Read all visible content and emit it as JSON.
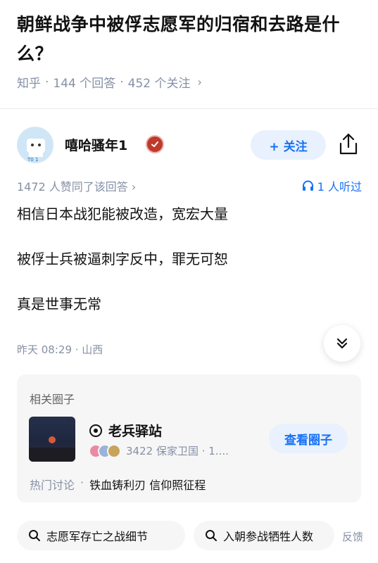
{
  "question": {
    "title": "朝鲜战争中被俘志愿军的归宿和去路是什么？",
    "source": "知乎",
    "answers": "144 个回答",
    "followers": "452 个关注"
  },
  "author": {
    "name": "嘻哈骚年1",
    "follow_label": "+ 关注"
  },
  "stats": {
    "agree": "1472 人赞同了该回答",
    "listen": "1 人听过"
  },
  "answer": {
    "paragraphs": [
      "相信日本战犯能被改造，宽宏大量",
      "被俘士兵被逼刺字反中，罪无可恕",
      "真是世事无常"
    ],
    "time_location": "昨天 08:29 · 山西"
  },
  "related_circle": {
    "section_title": "相关圈子",
    "name": "老兵驿站",
    "members": "3422 保家卫国 · 1....",
    "view_label": "查看圈子",
    "hot_label": "热门讨论",
    "hot_topic": "铁血铸利刃 信仰照征程"
  },
  "chips": [
    {
      "label": "志愿军存亡之战细节"
    },
    {
      "label": "入朝参战牺牲人数"
    }
  ],
  "feedback_label": "反馈",
  "colors": {
    "accent": "#1772f6",
    "muted": "#8590a6",
    "text": "#121212"
  }
}
